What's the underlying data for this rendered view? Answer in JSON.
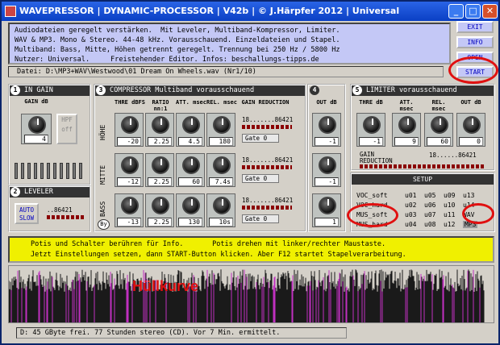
{
  "window": {
    "title": "WAVEPRESSOR | DYNAMIC-PROCESSOR | V42b | © J.Härpfer 2012 | Universal"
  },
  "info_lines": [
    "Audiodateien geregelt verstärken.  Mit Leveler, Multiband-Kompressor, Limiter.",
    "WAV & MP3. Mono & Stereo. 44-48 kHz. Vorausschauend. Einzeldateien und Stapel.",
    "Multiband: Bass, Mitte, Höhen getrennt geregelt. Trennung bei 250 Hz / 5800 Hz",
    "Nutzer: Universal.     Freistehender Editor. Infos: beschallungs-tipps.de"
  ],
  "side_buttons": {
    "exit": "EXIT",
    "info": "INFO",
    "open": "OPEN",
    "start": "START"
  },
  "path": "Datei: D:\\MP3+WAV\\Westwood\\01 Dream On Wheels.wav  (Nr1/10)",
  "in_gain": {
    "num": "1",
    "title": "IN GAIN",
    "header": "GAIN dB",
    "value": "4",
    "hpf": "HPF",
    "hpf_state": "off"
  },
  "leveler": {
    "num": "2",
    "title": "LEVELER",
    "button": "AUTO SLOW",
    "meter": "..86421"
  },
  "compressor": {
    "num": "3",
    "title": "COMPRESSOR  Multiband  vorausschauend",
    "headers": [
      "THRE dBFS",
      "RATIO nn:1",
      "ATT. msec",
      "REL. msec",
      "GAIN REDUCTION"
    ],
    "bands": [
      {
        "label": "HÖHE",
        "thre": "-20",
        "ratio": "2.25",
        "att": "4.5",
        "rel": "180",
        "meter": "18.......86421",
        "gate": "Gate 0"
      },
      {
        "label": "MITTE",
        "thre": "-12",
        "ratio": "2.25",
        "att": "60",
        "rel": "7.4s",
        "meter": "18.......86421",
        "gate": "Gate 0"
      },
      {
        "label": "BASS",
        "thre": "-13",
        "ratio": "2.25",
        "att": "130",
        "rel": "10s",
        "meter": "18.......86421",
        "gate": "Gate 0"
      }
    ],
    "bypass": "By"
  },
  "out": {
    "num": "4",
    "header": "OUT dB",
    "values": [
      "-1",
      "-1",
      "1"
    ]
  },
  "limiter": {
    "num": "5",
    "title": "LIMITER vorausschauend",
    "headers": [
      "THRE dB",
      "ATT. msec",
      "REL. msec",
      "OUT dB"
    ],
    "values": [
      "-1",
      "9",
      "60",
      "0"
    ],
    "gr_label": "GAIN REDUCTION",
    "meter": "18......86421"
  },
  "setup": {
    "title": "SETUP",
    "rows": [
      {
        "name": "VOC_soft",
        "cols": [
          "u01",
          "u05",
          "u09",
          "u13"
        ]
      },
      {
        "name": "VOC_hard",
        "cols": [
          "u02",
          "u06",
          "u10",
          "u14"
        ]
      },
      {
        "name": "MUS_soft",
        "cols": [
          "u03",
          "u07",
          "u11",
          "WAV"
        ]
      },
      {
        "name": "MUS_hard",
        "cols": [
          "u04",
          "u08",
          "u12",
          "MP3"
        ]
      }
    ]
  },
  "hint_lines": [
    "Potis und Schalter berühren für Info.       Potis drehen mit linker/rechter Maustaste.",
    "Jetzt Einstellungen setzen, dann START-Button klicken. Aber F12 startet Stapelverarbeitung."
  ],
  "annotation": "Hüllkurve",
  "status": "D: 45 GByte frei. 77 Stunden stereo (CD). Vor 7 Min. ermittelt."
}
